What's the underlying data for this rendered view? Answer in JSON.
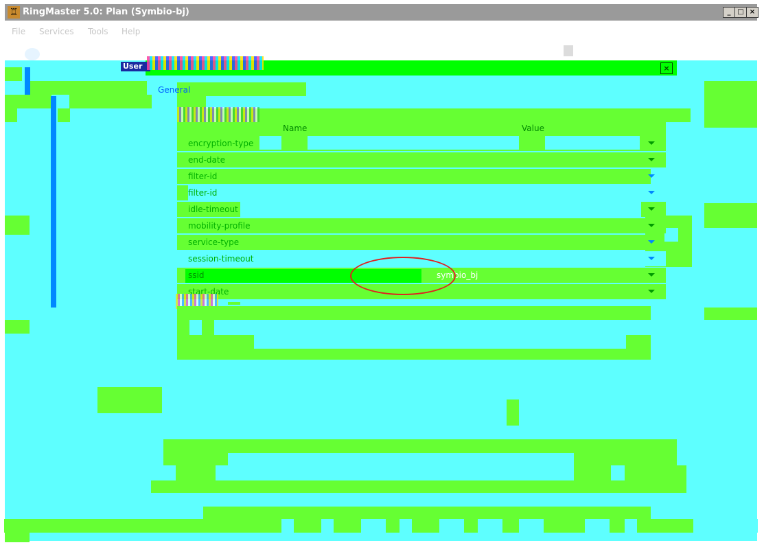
{
  "window": {
    "title": "RingMaster 5.0: Plan (Symbio-bj)",
    "app_icon": "ringmaster-icon"
  },
  "window_controls": {
    "minimize": "_",
    "maximize": "□",
    "close": "×"
  },
  "menu": {
    "items": [
      "File",
      "Services",
      "Tools",
      "Help"
    ]
  },
  "dialog": {
    "title_fragment": "User",
    "tabs": [
      "General"
    ],
    "columns": {
      "name": "Name",
      "value": "Value"
    },
    "rows": [
      {
        "name": "encryption-type",
        "value": ""
      },
      {
        "name": "end-date",
        "value": ""
      },
      {
        "name": "filter-id",
        "value": ""
      },
      {
        "name": "filter-id",
        "value": ""
      },
      {
        "name": "idle-timeout",
        "value": ""
      },
      {
        "name": "mobility-profile",
        "value": ""
      },
      {
        "name": "service-type",
        "value": ""
      },
      {
        "name": "session-timeout",
        "value": ""
      },
      {
        "name": "ssid",
        "value": "symbio_bj"
      },
      {
        "name": "start-date",
        "value": ""
      }
    ],
    "close_label": "×"
  },
  "colors": {
    "annotation_ellipse": "#e02020",
    "dialog_fill": "#66ff33",
    "background_fill": "#5effff"
  }
}
